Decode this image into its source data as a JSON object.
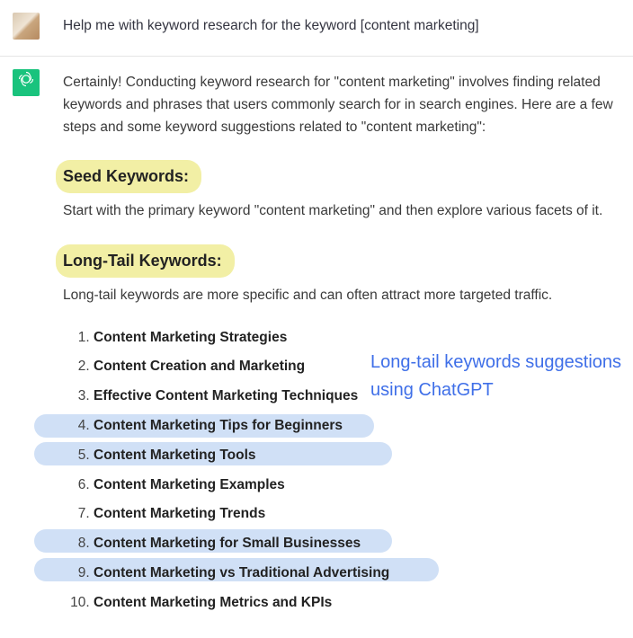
{
  "user": {
    "prompt": "Help me with keyword research for the keyword [content marketing]"
  },
  "assistant": {
    "intro": "Certainly! Conducting keyword research for \"content marketing\" involves finding related keywords and phrases that users commonly search for in search engines. Here are a few steps and some keyword suggestions related to \"content marketing\":",
    "sections": {
      "seed": {
        "heading": "Seed Keywords:",
        "body": "Start with the primary keyword \"content marketing\" and then explore various facets of it."
      },
      "longtail": {
        "heading": "Long-Tail Keywords:",
        "body": "Long-tail keywords are more specific and can often attract more targeted traffic."
      }
    },
    "keywords": [
      "Content Marketing Strategies",
      "Content Creation and Marketing",
      "Effective Content Marketing Techniques",
      "Content Marketing Tips for Beginners",
      "Content Marketing Tools",
      "Content Marketing Examples",
      "Content Marketing Trends",
      "Content Marketing for Small Businesses",
      "Content Marketing vs Traditional Advertising",
      "Content Marketing Metrics and KPIs"
    ]
  },
  "annotation": "Long-tail keywords suggestions using ChatGPT"
}
